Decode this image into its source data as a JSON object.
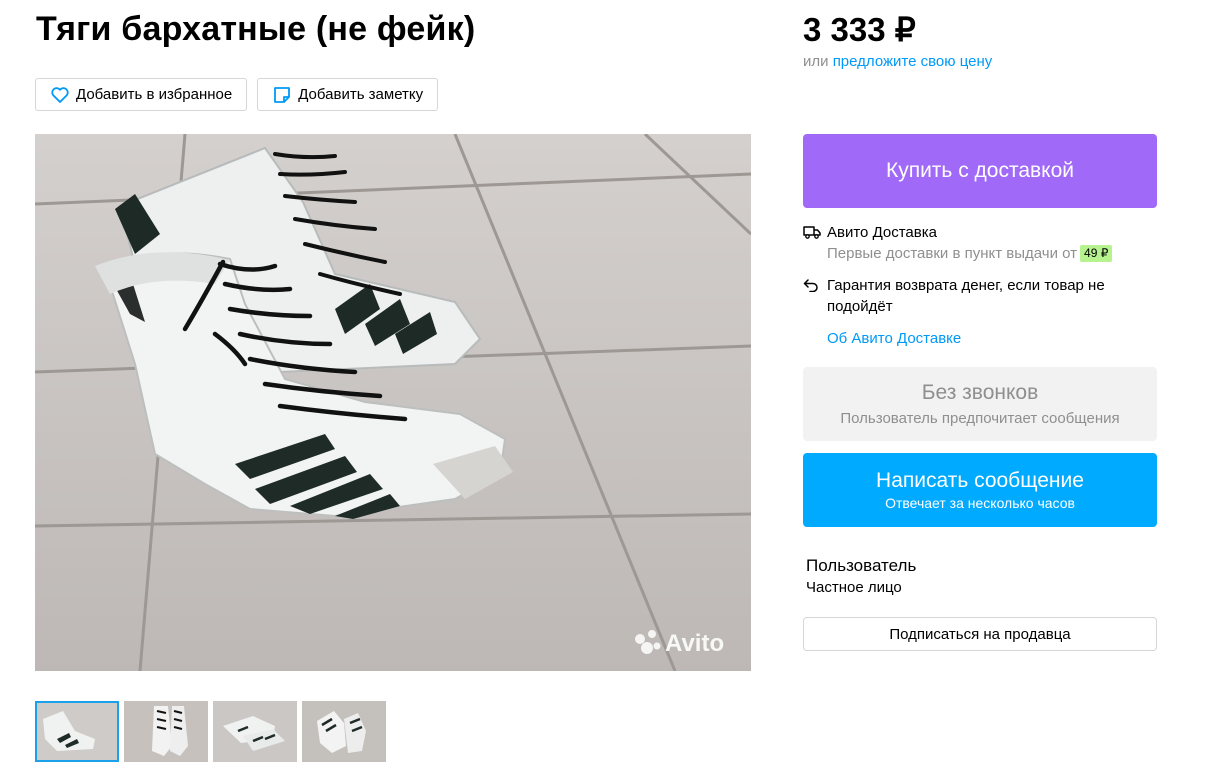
{
  "listing": {
    "title": "Тяги бархатные (не фейк)",
    "favorite_label": "Добавить в избранное",
    "note_label": "Добавить заметку",
    "watermark": "Avito"
  },
  "price": {
    "value": "3 333 ₽",
    "offer_prefix": "или",
    "offer_link": "предложите свою цену"
  },
  "purchase": {
    "buy_label": "Купить с доставкой",
    "delivery_title": "Авито Доставка",
    "delivery_note": "Первые доставки в пункт выдачи от",
    "delivery_price": "49 ₽",
    "guarantee": "Гарантия возврата денег, если товар не подойдёт",
    "about_link": "Об Авито Доставке"
  },
  "contact": {
    "no_calls_title": "Без звонков",
    "no_calls_note": "Пользователь предпочитает сообщения",
    "message_label": "Написать сообщение",
    "message_note": "Отвечает за несколько часов"
  },
  "seller": {
    "name": "Пользователь",
    "type": "Частное лицо",
    "subscribe_label": "Подписаться на продавца"
  },
  "gallery": {
    "selected_index": 0,
    "thumbnail_count": 4
  },
  "colors": {
    "buy_button": "#a069f8",
    "message_button": "#00aaff",
    "link": "#0099f7",
    "price_badge": "#b6f38f"
  }
}
